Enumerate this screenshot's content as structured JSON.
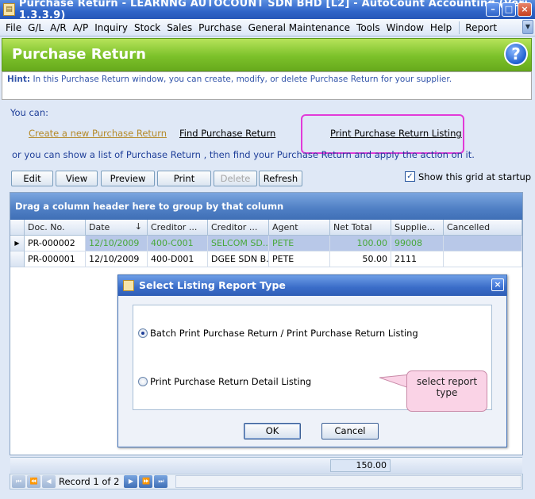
{
  "window": {
    "title": "Purchase Return - LEARNNG AUTOCOUNT SDN BHD [L2] - AutoCount Accounting (Ver: 1.3.3.9)"
  },
  "menu": {
    "items": [
      "File",
      "G/L",
      "A/R",
      "A/P",
      "Inquiry",
      "Stock",
      "Sales",
      "Purchase",
      "General Maintenance",
      "Tools",
      "Window",
      "Help"
    ],
    "report": "Report"
  },
  "header": {
    "title": "Purchase Return",
    "help_glyph": "?"
  },
  "hint": {
    "label": "Hint:",
    "text": "In this Purchase Return window, you can create, modify, or delete Purchase Return for your supplier."
  },
  "actions": {
    "you_can": "You can:",
    "create": "Create a new Purchase Return",
    "find": "Find Purchase Return",
    "print_listing": "Print Purchase Return Listing",
    "or_text": "or you can show a  list of Purchase Return , then find your Purchase Return and apply  the action on it."
  },
  "toolbar": {
    "edit": "Edit",
    "view": "View",
    "preview": "Preview",
    "print": "Print",
    "delete": "Delete",
    "refresh": "Refresh",
    "show_grid": "Show this grid at startup",
    "show_grid_checked": true
  },
  "grid": {
    "group_hint": "Drag a column header here to group by that column",
    "columns": [
      "Doc. No.",
      "Date",
      "Creditor ...",
      "Creditor ...",
      "Agent",
      "Net Total",
      "Supplie...",
      "Cancelled"
    ],
    "rows": [
      [
        "PR-000002",
        "12/10/2009",
        "400-C001",
        "SELCOM SD...",
        "PETE",
        "100.00",
        "99008",
        ""
      ],
      [
        "PR-000001",
        "12/10/2009",
        "400-D001",
        "DGEE SDN B...",
        "PETE",
        "50.00",
        "2111",
        ""
      ]
    ],
    "total": "150.00"
  },
  "nav": {
    "record": "Record 1 of 2"
  },
  "dialog": {
    "title": "Select Listing Report Type",
    "option1": "Batch Print Purchase Return / Print Purchase Return Listing",
    "option2": "Print Purchase Return Detail Listing",
    "ok": "OK",
    "cancel": "Cancel"
  },
  "callout": {
    "line1": "select report",
    "line2": "type"
  }
}
